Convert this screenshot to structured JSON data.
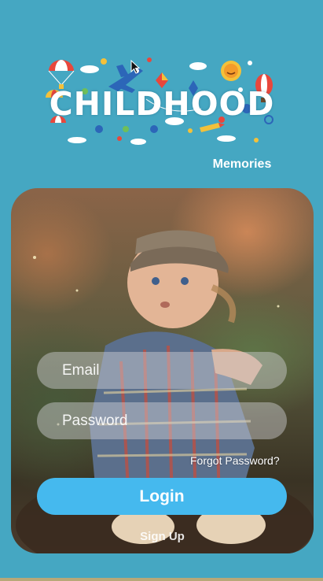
{
  "brand": {
    "title": "CHILDHOOD",
    "tagline": "Memories"
  },
  "login_form": {
    "email_placeholder": "Email",
    "password_placeholder": "Password",
    "forgot_label": "Forgot Password?",
    "login_label": "Login",
    "signup_label": "Sign Up"
  },
  "colors": {
    "background": "#45a7c2",
    "login_button": "#45b9ee",
    "text": "#ffffff"
  },
  "icons": [
    "parachute-icon",
    "airplane-icon",
    "kite-icon",
    "sun-icon",
    "balloon-icon",
    "cloud-icon",
    "mouse-cursor-icon"
  ]
}
